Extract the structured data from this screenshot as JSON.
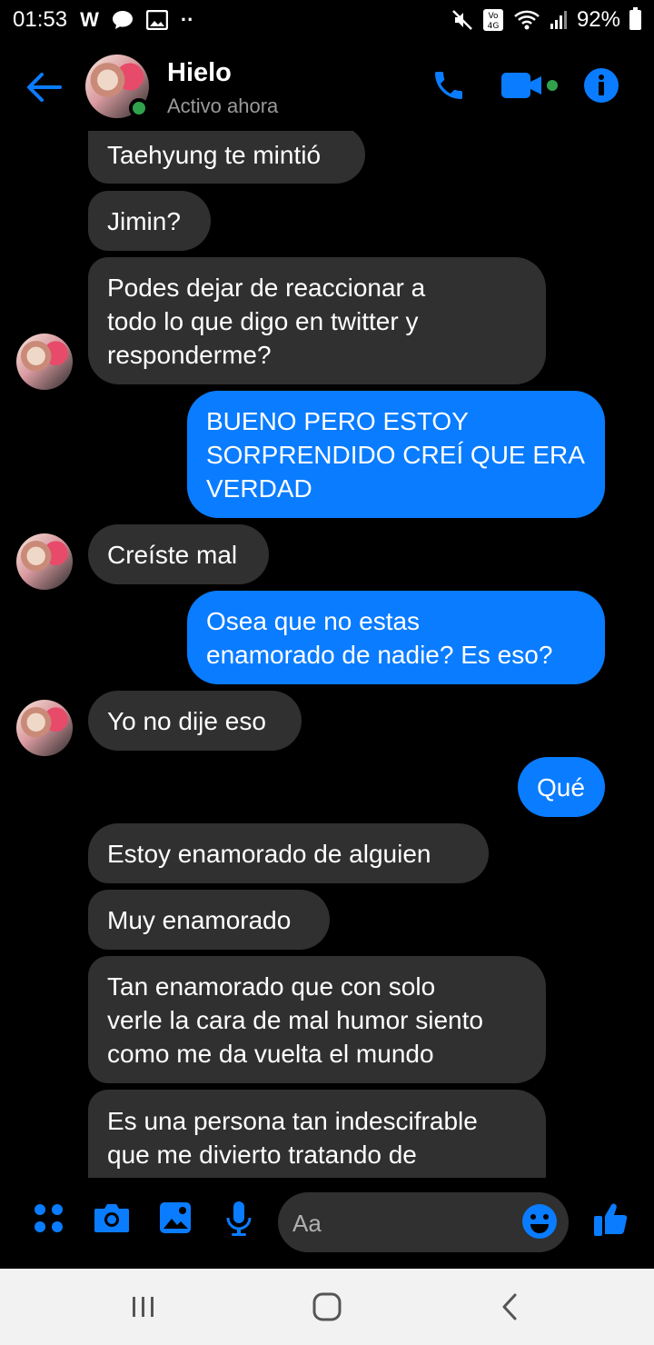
{
  "status_bar": {
    "time": "01:53",
    "battery": "92%"
  },
  "header": {
    "name": "Hielo",
    "status": "Activo ahora"
  },
  "messages": [
    {
      "text": "Taehyung te mintió"
    },
    {
      "text": "Jimin?"
    },
    {
      "text": "Podes dejar de reaccionar a\ntodo lo que digo en twitter y\nresponderme?"
    },
    {
      "text": "BUENO PERO ESTOY\nSORPRENDIDO CREÍ QUE ERA\nVERDAD"
    },
    {
      "text": "Creíste mal"
    },
    {
      "text": "Osea que no estas\nenamorado de nadie? Es eso?"
    },
    {
      "text": "Yo no dije eso"
    },
    {
      "text": "Qué"
    },
    {
      "text": "Estoy enamorado de alguien"
    },
    {
      "text": "Muy enamorado"
    },
    {
      "text": "Tan enamorado que con solo\nverle la cara de mal humor siento\ncomo me da vuelta el mundo"
    },
    {
      "text": "Es una persona tan indescifrable\nque me divierto tratando de\nentenderla"
    }
  ],
  "composer": {
    "placeholder": "Aa"
  },
  "colors": {
    "accent": "#0a7cff",
    "incoming_bubble": "#303030",
    "online": "#31a24c"
  }
}
